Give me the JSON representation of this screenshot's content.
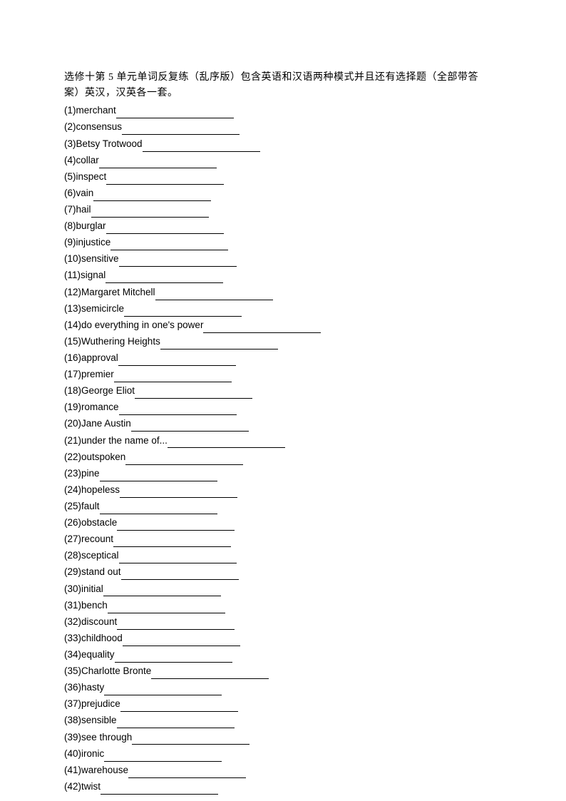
{
  "title_line1": "选修十第 5 单元单词反复练（乱序版）包含英语和汉语两种模式并且还有选择题（全部带答",
  "title_line2": "案）英汉，汉英各一套。",
  "items": [
    {
      "n": "(1)",
      "word": "merchant",
      "blank": 165
    },
    {
      "n": "(2)",
      "word": "consensus",
      "blank": 165
    },
    {
      "n": "(3)",
      "word": "Betsy Trotwood",
      "blank": 165
    },
    {
      "n": "(4)",
      "word": "collar",
      "blank": 165
    },
    {
      "n": "(5)",
      "word": "inspect",
      "blank": 165
    },
    {
      "n": "(6)",
      "word": "vain",
      "blank": 165
    },
    {
      "n": "(7)",
      "word": "hail",
      "blank": 165
    },
    {
      "n": "(8)",
      "word": "burglar",
      "blank": 165
    },
    {
      "n": "(9)",
      "word": "injustice",
      "blank": 165
    },
    {
      "n": "(10)",
      "word": "sensitive",
      "blank": 165
    },
    {
      "n": "(11)",
      "word": "signal",
      "blank": 165
    },
    {
      "n": "(12)",
      "word": "Margaret Mitchell",
      "blank": 165
    },
    {
      "n": "(13)",
      "word": "semicircle",
      "blank": 165
    },
    {
      "n": "(14)",
      "word": "do everything in one's power",
      "blank": 165
    },
    {
      "n": "(15)",
      "word": "Wuthering Heights",
      "blank": 165
    },
    {
      "n": "(16)",
      "word": "approval",
      "blank": 165
    },
    {
      "n": "(17)",
      "word": "premier",
      "blank": 165
    },
    {
      "n": "(18)",
      "word": "George Eliot",
      "blank": 165
    },
    {
      "n": "(19)",
      "word": "romance",
      "blank": 165
    },
    {
      "n": "(20)",
      "word": "Jane Austin",
      "blank": 165
    },
    {
      "n": "(21)",
      "word": "under the name of...",
      "blank": 165
    },
    {
      "n": "(22)",
      "word": "outspoken",
      "blank": 165
    },
    {
      "n": "(23)",
      "word": "pine",
      "blank": 165
    },
    {
      "n": "(24)",
      "word": "hopeless",
      "blank": 165
    },
    {
      "n": "(25)",
      "word": "fault",
      "blank": 165
    },
    {
      "n": "(26)",
      "word": "obstacle",
      "blank": 165
    },
    {
      "n": "(27)",
      "word": "recount",
      "blank": 165
    },
    {
      "n": "(28)",
      "word": "sceptical",
      "blank": 165
    },
    {
      "n": "(29)",
      "word": "stand out",
      "blank": 165
    },
    {
      "n": "(30)",
      "word": "initial",
      "blank": 165
    },
    {
      "n": "(31)",
      "word": "bench",
      "blank": 165
    },
    {
      "n": "(32)",
      "word": "discount",
      "blank": 165
    },
    {
      "n": "(33)",
      "word": "childhood",
      "blank": 165
    },
    {
      "n": "(34)",
      "word": "equality",
      "blank": 165
    },
    {
      "n": "(35)",
      "word": "Charlotte Bronte",
      "blank": 165
    },
    {
      "n": "(36)",
      "word": "hasty",
      "blank": 165
    },
    {
      "n": "(37)",
      "word": "prejudice",
      "blank": 165
    },
    {
      "n": "(38)",
      "word": "sensible",
      "blank": 165
    },
    {
      "n": "(39)",
      "word": "see through",
      "blank": 165
    },
    {
      "n": "(40)",
      "word": "ironic",
      "blank": 165
    },
    {
      "n": "(41)",
      "word": "warehouse",
      "blank": 165
    },
    {
      "n": "(42)",
      "word": "twist",
      "blank": 165
    }
  ]
}
